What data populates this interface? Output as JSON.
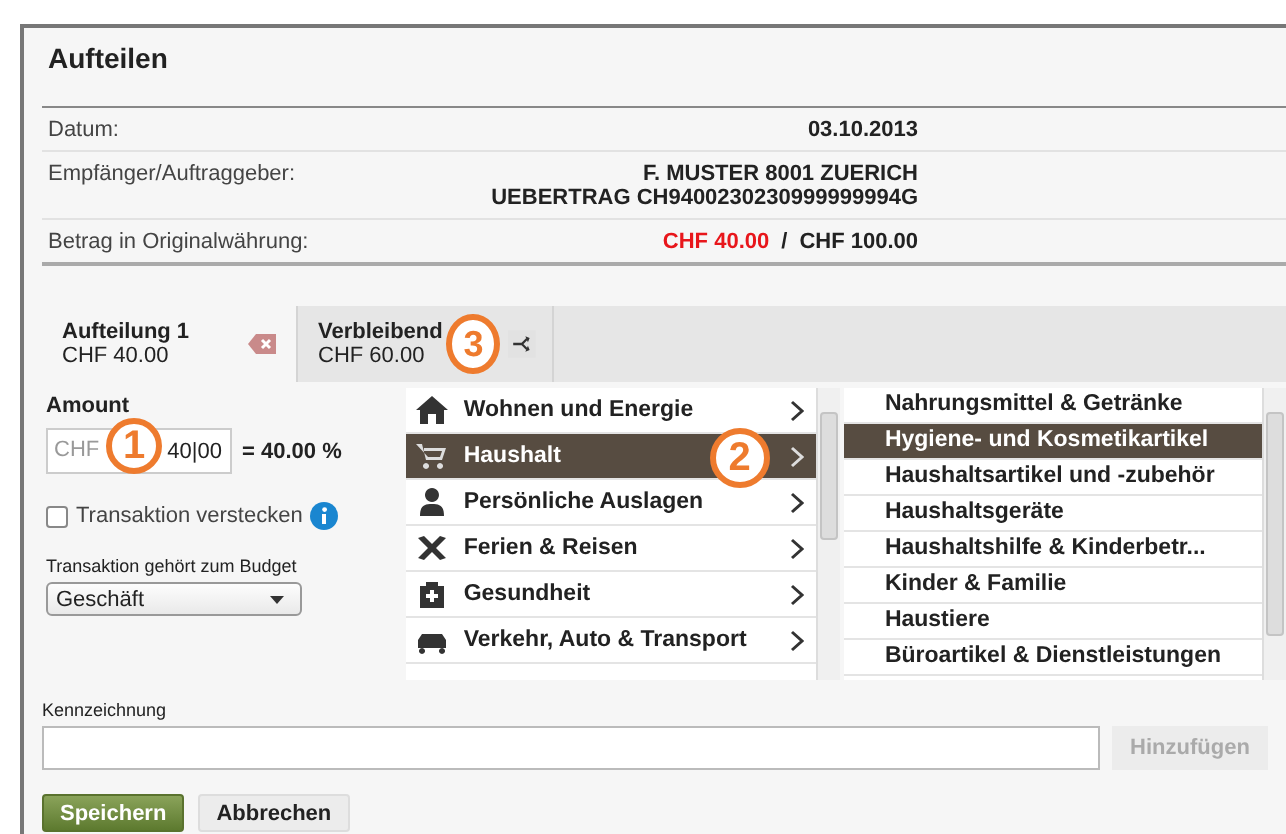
{
  "dialog": {
    "title": "Aufteilen"
  },
  "details": [
    {
      "label": "Datum:",
      "lines": [
        "03.10.2013"
      ]
    },
    {
      "label": "Empfänger/Auftraggeber:",
      "lines": [
        "F. MUSTER 8001 ZUERICH",
        "UEBERTRAG CH9400230230999999994G"
      ]
    }
  ],
  "original_amount": {
    "label": "Betrag in Originalwährung:",
    "split": "CHF 40.00",
    "separator": "/",
    "total": "CHF 100.00"
  },
  "tabs": [
    {
      "title": "Aufteilung 1",
      "amount": "CHF 40.00",
      "selected": true,
      "kind": "delete"
    },
    {
      "title": "Verbleibend",
      "amount": "CHF 60.00",
      "selected": false,
      "kind": "split"
    }
  ],
  "amount": {
    "label": "Amount",
    "currency": "CHF",
    "value": "40|00",
    "percent": "= 40.00 %"
  },
  "hide": {
    "label": "Transaktion verstecken",
    "checked": false
  },
  "budget": {
    "label": "Transaktion gehört zum Budget",
    "value": "Geschäft"
  },
  "categories": [
    {
      "label": "Wohnen und Energie",
      "kind": "house",
      "selected": false
    },
    {
      "label": "Haushalt",
      "kind": "cart",
      "selected": true
    },
    {
      "label": "Persönliche Auslagen",
      "kind": "person",
      "selected": false
    },
    {
      "label": "Ferien & Reisen",
      "kind": "plane",
      "selected": false
    },
    {
      "label": "Gesundheit",
      "kind": "medkit",
      "selected": false
    },
    {
      "label": "Verkehr, Auto & Transport",
      "kind": "car",
      "selected": false
    }
  ],
  "subcategories": [
    {
      "label": "Nahrungsmittel & Getränke",
      "selected": false
    },
    {
      "label": "Hygiene- und Kosmetikartikel",
      "selected": true
    },
    {
      "label": "Haushaltsartikel und -zubehör",
      "selected": false
    },
    {
      "label": "Haushaltsgeräte",
      "selected": false
    },
    {
      "label": "Haushaltshilfe & Kinderbetr...",
      "selected": false
    },
    {
      "label": "Kinder & Familie",
      "selected": false
    },
    {
      "label": "Haustiere",
      "selected": false
    },
    {
      "label": "Büroartikel & Dienstleistungen",
      "selected": false
    }
  ],
  "tag": {
    "label": "Kennzeichnung",
    "add_button": "Hinzufügen",
    "add_disabled": true
  },
  "buttons": [
    {
      "label": "Speichern",
      "kind": "primary"
    },
    {
      "label": "Abbrechen",
      "kind": "secondary"
    }
  ],
  "markers": [
    "1",
    "2",
    "3"
  ]
}
